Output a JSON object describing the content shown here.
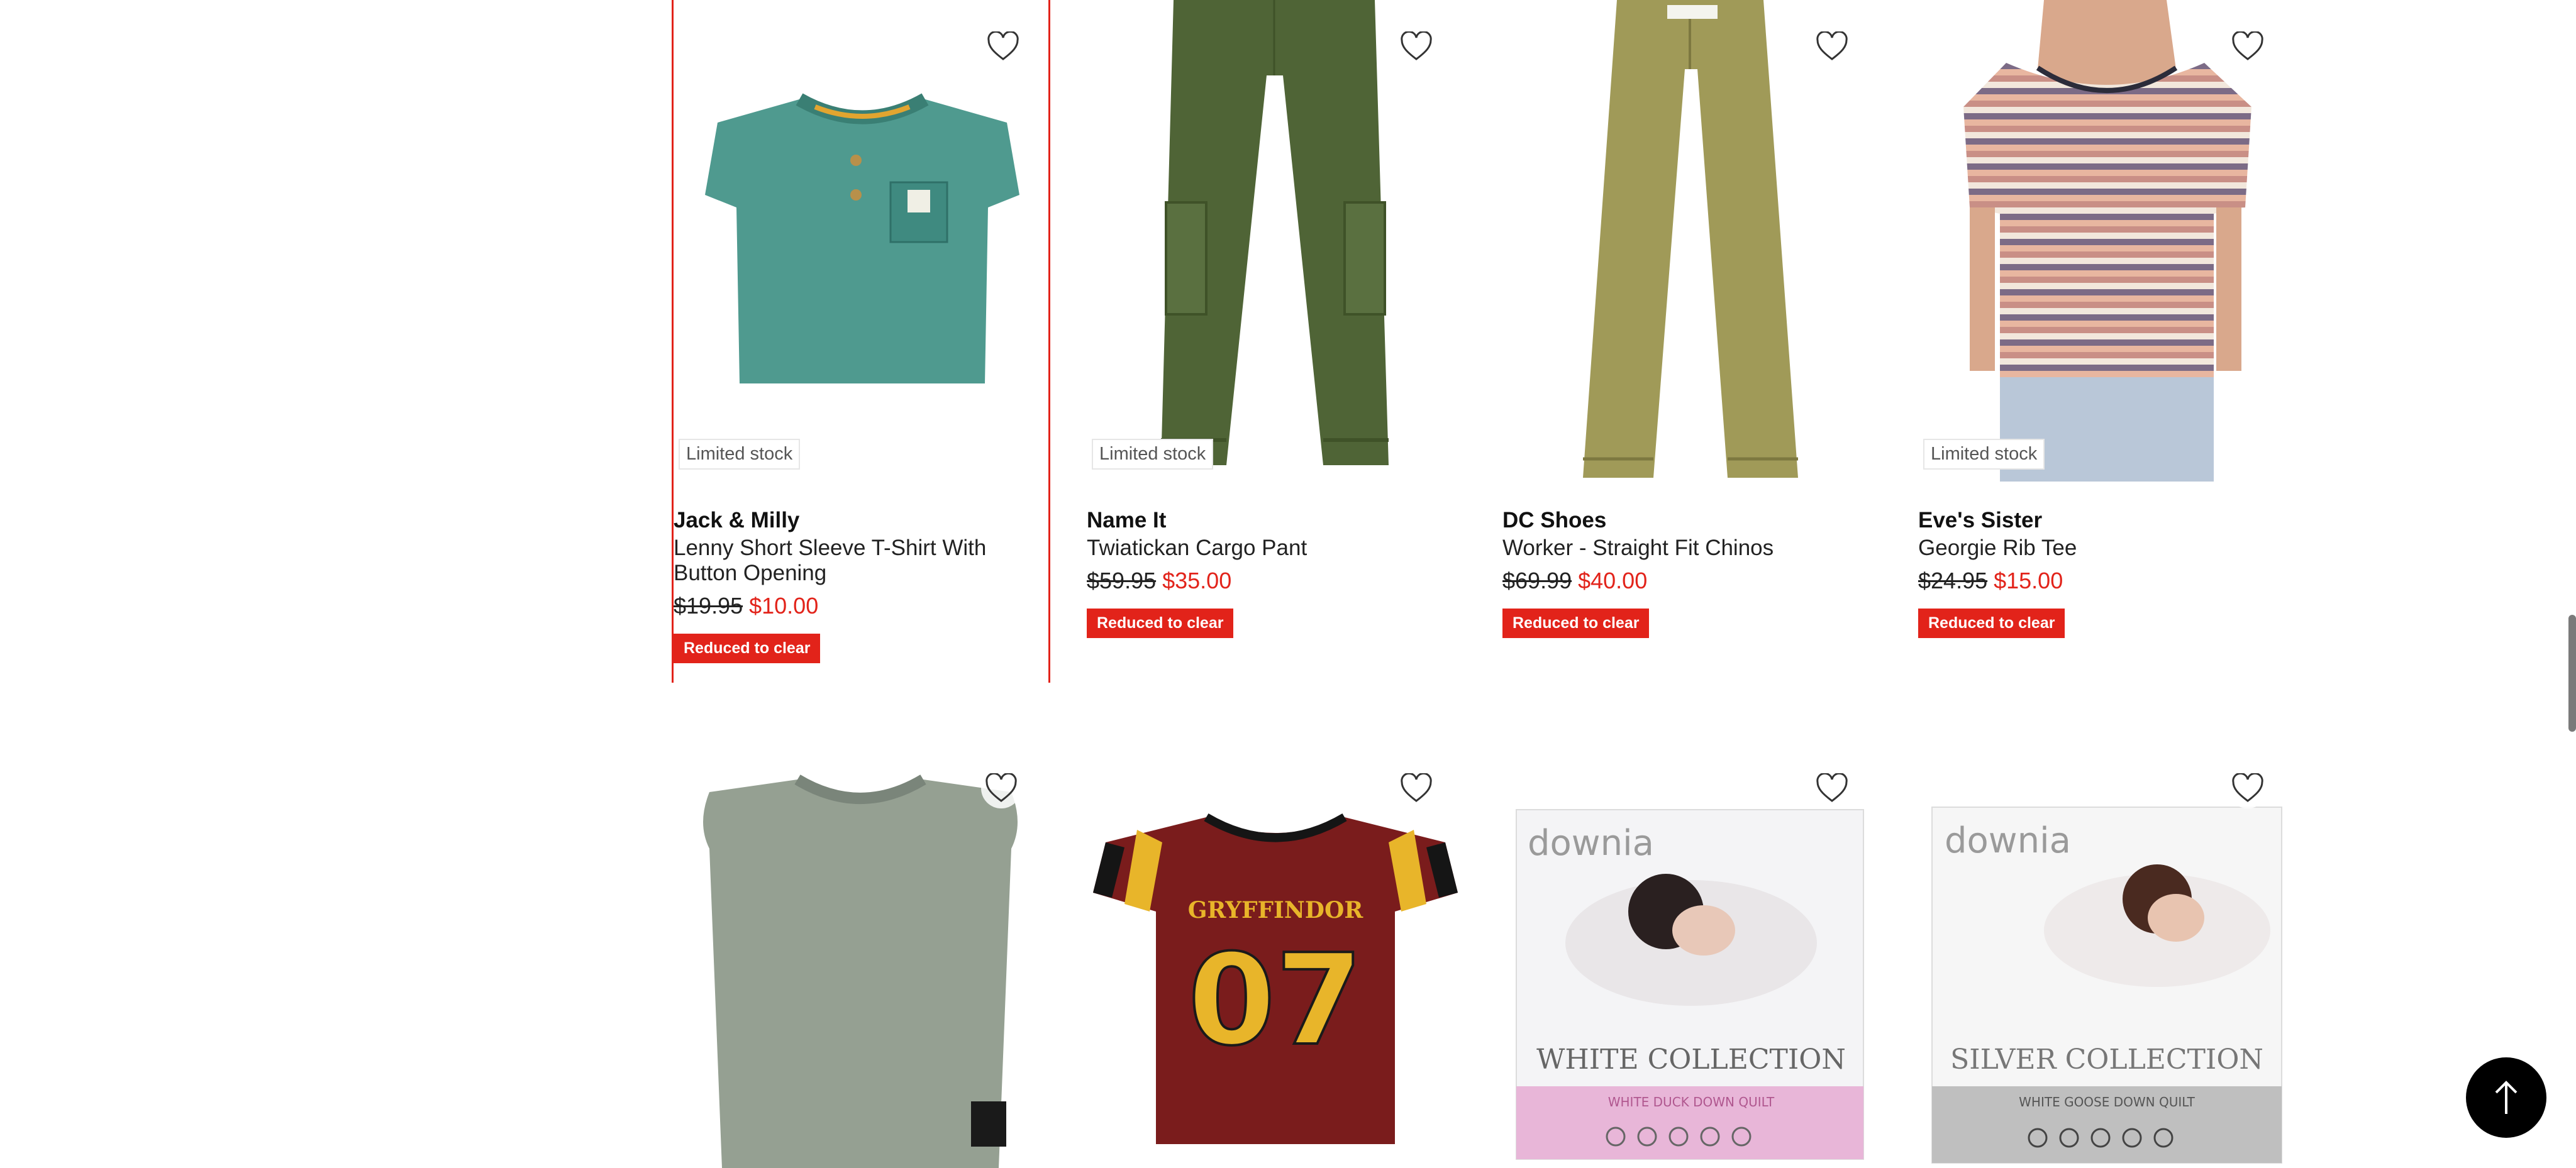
{
  "products": [
    {
      "stock": "Limited stock",
      "brand": "Jack & Milly",
      "name": "Lenny Short Sleeve T-Shirt With Button Opening",
      "was": "$19.95",
      "now": "$10.00",
      "badge": "Reduced to clear"
    },
    {
      "stock": "Limited stock",
      "brand": "Name It",
      "name": "Twiatickan Cargo Pant",
      "was": "$59.95",
      "now": "$35.00",
      "badge": "Reduced to clear"
    },
    {
      "stock": "",
      "brand": "DC Shoes",
      "name": "Worker - Straight Fit Chinos",
      "was": "$69.99",
      "now": "$40.00",
      "badge": "Reduced to clear"
    },
    {
      "stock": "Limited stock",
      "brand": "Eve's Sister",
      "name": "Georgie Rib Tee",
      "was": "$24.95",
      "now": "$15.00",
      "badge": "Reduced to clear"
    }
  ],
  "images": {
    "tee_print": "GRYFFINDOR",
    "tee_number": "07",
    "quilt1_brand": "downia",
    "quilt1_title": "WHITE COLLECTION",
    "quilt1_sub": "WHITE DUCK DOWN QUILT",
    "quilt2_brand": "downia",
    "quilt2_title": "SILVER COLLECTION",
    "quilt2_sub": "WHITE GOOSE DOWN QUILT"
  },
  "icons": {
    "wishlist": "heart-outline-icon",
    "back_to_top": "arrow-up-icon"
  },
  "colors": {
    "accent": "#e2231a",
    "text": "#1a1a1a",
    "back_to_top_bg": "#000000"
  }
}
